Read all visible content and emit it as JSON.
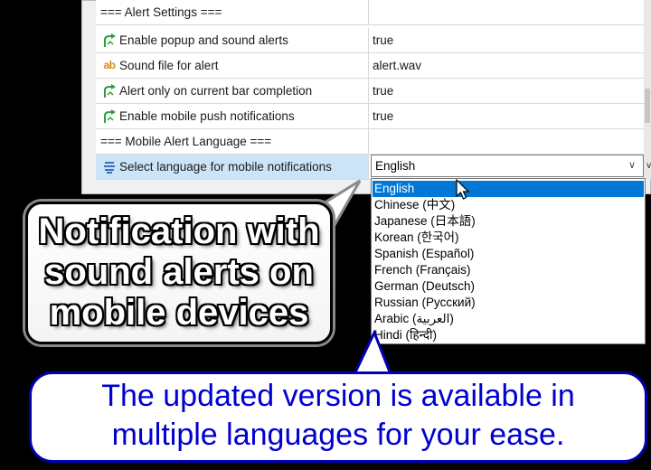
{
  "properties": {
    "rows": [
      {
        "name": "=== Alert Settings ===",
        "value": "",
        "icon": "",
        "type": "group"
      },
      {
        "name": "Enable popup and sound alerts",
        "value": "true",
        "icon": "bool-arrow-icon",
        "type": "bool"
      },
      {
        "name": "Sound file for alert",
        "value": "alert.wav",
        "icon": "text-ab-icon",
        "type": "text"
      },
      {
        "name": "Alert only on current bar completion",
        "value": "true",
        "icon": "bool-arrow-icon",
        "type": "bool"
      },
      {
        "name": "Enable mobile push notifications",
        "value": "true",
        "icon": "bool-arrow-icon",
        "type": "bool"
      },
      {
        "name": "=== Mobile Alert Language ===",
        "value": "",
        "icon": "",
        "type": "group"
      },
      {
        "name": "Select language for mobile notifications",
        "value": "English",
        "icon": "enum-list-icon",
        "type": "enum"
      }
    ],
    "ab_glyph": "ab"
  },
  "language_dropdown": {
    "selected": "English",
    "options": [
      "English",
      "Chinese (中文)",
      "Japanese (日本語)",
      "Korean (한국어)",
      "Spanish (Español)",
      "French (Français)",
      "German (Deutsch)",
      "Russian (Русский)",
      "Arabic (العربية)",
      "Hindi (हिन्दी)"
    ],
    "highlighted_index": 0
  },
  "callouts": {
    "primary_lines": [
      "Notification with",
      "sound alerts on",
      "mobile devices"
    ],
    "secondary_lines": [
      "The updated version is available in",
      "multiple languages for your ease."
    ]
  },
  "colors": {
    "selection": "#0078d7",
    "row_selected": "#cce4f7",
    "bool_icon": "#2e9e3a",
    "text_icon": "#d9881c",
    "callout2_text": "#0000d0",
    "callout2_border": "#0000b0"
  }
}
